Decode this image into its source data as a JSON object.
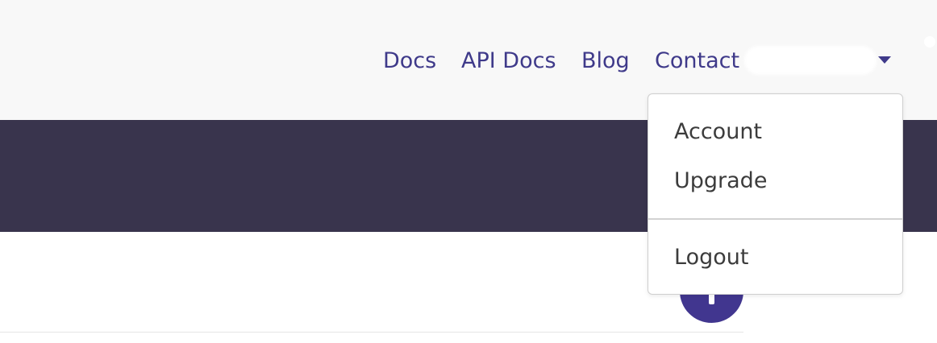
{
  "nav": {
    "links": [
      {
        "label": "Docs"
      },
      {
        "label": "API Docs"
      },
      {
        "label": "Blog"
      },
      {
        "label": "Contact"
      }
    ],
    "user_menu": {
      "username": "",
      "redacted": true,
      "caret_icon": "caret-down-icon"
    }
  },
  "dropdown": {
    "items": [
      {
        "label": "Account"
      },
      {
        "label": "Upgrade"
      },
      {
        "label": "Logout"
      }
    ]
  },
  "fab": {
    "icon": "exclamation-icon"
  },
  "colors": {
    "nav_background": "#f8f8f8",
    "link_text": "#3f3a8a",
    "hero_band": "#39344d",
    "menu_text": "#3c3c3c",
    "fab": "#41368f",
    "menu_border": "#cfcfcf"
  }
}
